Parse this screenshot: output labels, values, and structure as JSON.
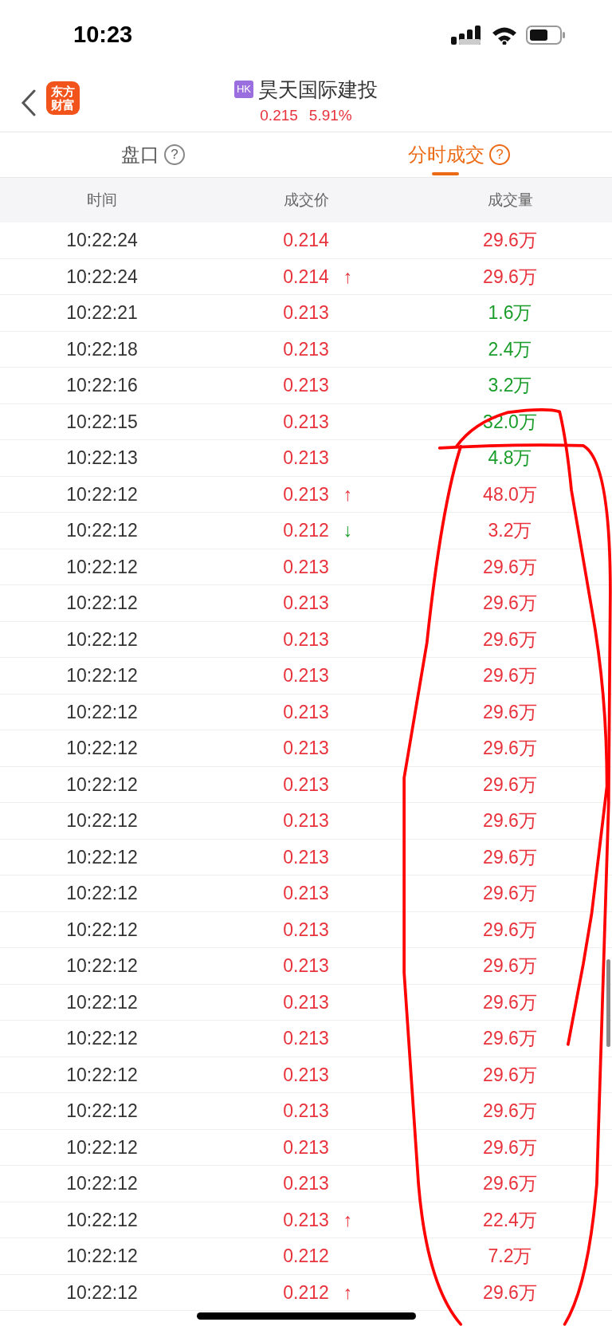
{
  "status_bar": {
    "time": "10:23"
  },
  "nav": {
    "logo_lines": [
      "东方",
      "财富"
    ],
    "badge": "HK",
    "name": "昊天国际建投",
    "price": "0.215",
    "change": "5.91%"
  },
  "tabs": [
    {
      "label": "盘口",
      "help": "?",
      "selected": false
    },
    {
      "label": "分时成交",
      "help": "?",
      "selected": true
    }
  ],
  "columns": [
    "时间",
    "成交价",
    "成交量"
  ],
  "rows": [
    {
      "time": "10:22:24",
      "price": "0.214",
      "volume": "29.6万",
      "color": "#e8323c"
    },
    {
      "time": "10:22:24",
      "price": "0.214",
      "arrow": {
        "symbol": "↑",
        "color": "#e8323c"
      },
      "volume": "29.6万",
      "color": "#e8323c"
    },
    {
      "time": "10:22:21",
      "price": "0.213",
      "volume": "1.6万",
      "color": "#1a9d2a"
    },
    {
      "time": "10:22:18",
      "price": "0.213",
      "volume": "2.4万",
      "color": "#1a9d2a"
    },
    {
      "time": "10:22:16",
      "price": "0.213",
      "volume": "3.2万",
      "color": "#1a9d2a"
    },
    {
      "time": "10:22:15",
      "price": "0.213",
      "volume": "32.0万",
      "color": "#1a9d2a"
    },
    {
      "time": "10:22:13",
      "price": "0.213",
      "volume": "4.8万",
      "color": "#1a9d2a"
    },
    {
      "time": "10:22:12",
      "price": "0.213",
      "arrow": {
        "symbol": "↑",
        "color": "#e8323c"
      },
      "volume": "48.0万",
      "color": "#e8323c"
    },
    {
      "time": "10:22:12",
      "price": "0.212",
      "arrow": {
        "symbol": "↓",
        "color": "#1a9d2a"
      },
      "volume": "3.2万",
      "color": "#e8323c"
    },
    {
      "time": "10:22:12",
      "price": "0.213",
      "volume": "29.6万",
      "color": "#e8323c"
    },
    {
      "time": "10:22:12",
      "price": "0.213",
      "volume": "29.6万",
      "color": "#e8323c"
    },
    {
      "time": "10:22:12",
      "price": "0.213",
      "volume": "29.6万",
      "color": "#e8323c"
    },
    {
      "time": "10:22:12",
      "price": "0.213",
      "volume": "29.6万",
      "color": "#e8323c"
    },
    {
      "time": "10:22:12",
      "price": "0.213",
      "volume": "29.6万",
      "color": "#e8323c"
    },
    {
      "time": "10:22:12",
      "price": "0.213",
      "volume": "29.6万",
      "color": "#e8323c"
    },
    {
      "time": "10:22:12",
      "price": "0.213",
      "volume": "29.6万",
      "color": "#e8323c"
    },
    {
      "time": "10:22:12",
      "price": "0.213",
      "volume": "29.6万",
      "color": "#e8323c"
    },
    {
      "time": "10:22:12",
      "price": "0.213",
      "volume": "29.6万",
      "color": "#e8323c"
    },
    {
      "time": "10:22:12",
      "price": "0.213",
      "volume": "29.6万",
      "color": "#e8323c"
    },
    {
      "time": "10:22:12",
      "price": "0.213",
      "volume": "29.6万",
      "color": "#e8323c"
    },
    {
      "time": "10:22:12",
      "price": "0.213",
      "volume": "29.6万",
      "color": "#e8323c"
    },
    {
      "time": "10:22:12",
      "price": "0.213",
      "volume": "29.6万",
      "color": "#e8323c"
    },
    {
      "time": "10:22:12",
      "price": "0.213",
      "volume": "29.6万",
      "color": "#e8323c"
    },
    {
      "time": "10:22:12",
      "price": "0.213",
      "volume": "29.6万",
      "color": "#e8323c"
    },
    {
      "time": "10:22:12",
      "price": "0.213",
      "volume": "29.6万",
      "color": "#e8323c"
    },
    {
      "time": "10:22:12",
      "price": "0.213",
      "volume": "29.6万",
      "color": "#e8323c"
    },
    {
      "time": "10:22:12",
      "price": "0.213",
      "volume": "29.6万",
      "color": "#e8323c"
    },
    {
      "time": "10:22:12",
      "price": "0.213",
      "arrow": {
        "symbol": "↑",
        "color": "#e8323c"
      },
      "volume": "22.4万",
      "color": "#e8323c"
    },
    {
      "time": "10:22:12",
      "price": "0.212",
      "volume": "7.2万",
      "color": "#e8323c"
    },
    {
      "time": "10:22:12",
      "price": "0.212",
      "arrow": {
        "symbol": "↑",
        "color": "#e8323c"
      },
      "volume": "29.6万",
      "color": "#e8323c"
    }
  ]
}
